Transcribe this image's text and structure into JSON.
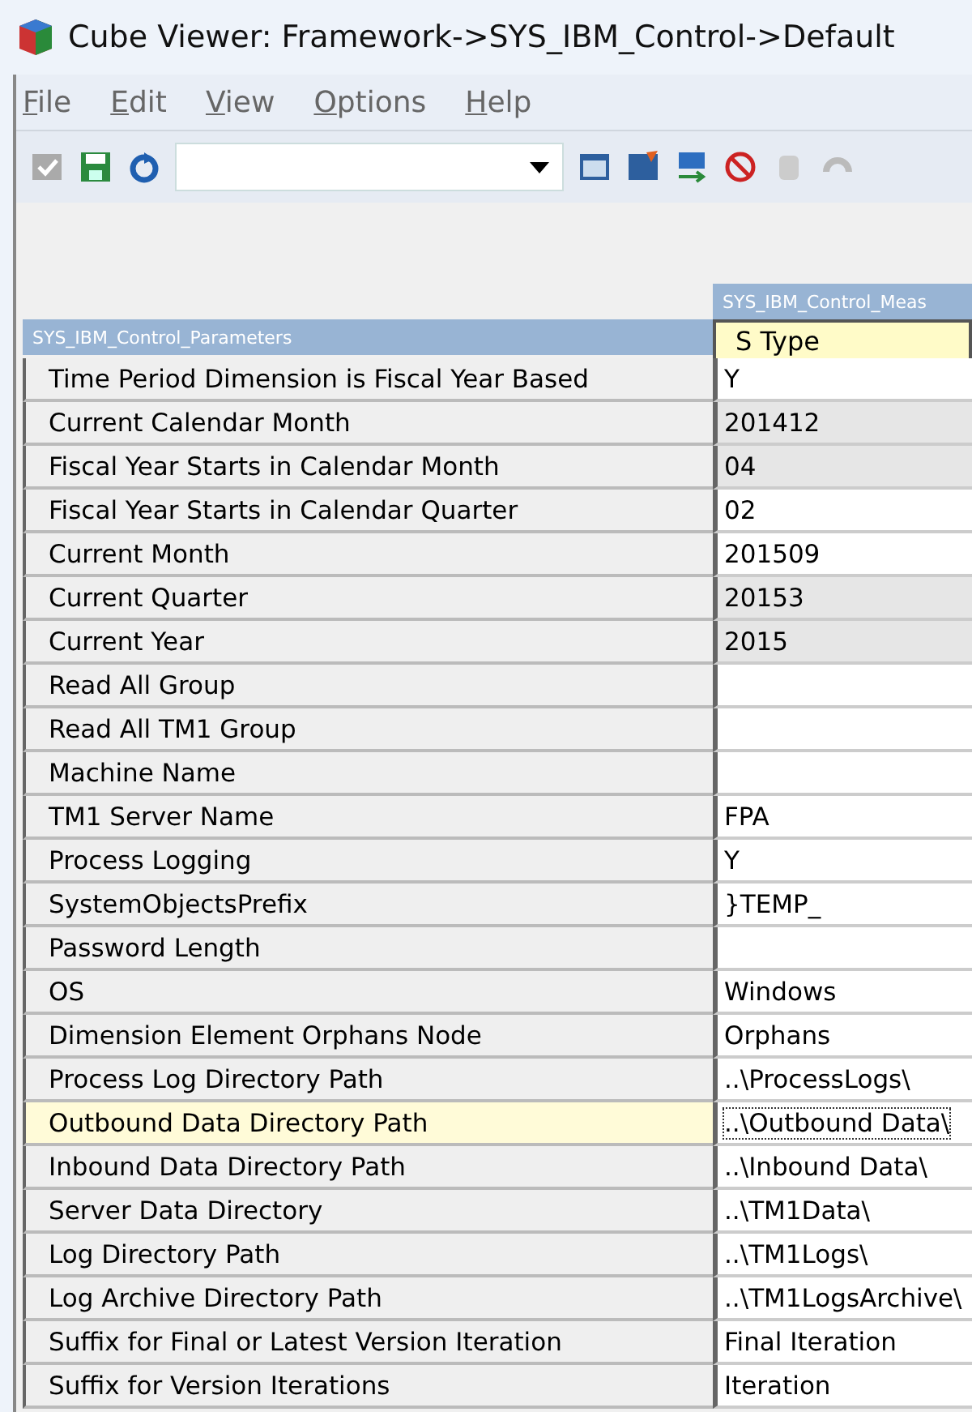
{
  "window": {
    "title": "Cube Viewer: Framework->SYS_IBM_Control->Default"
  },
  "menu": [
    {
      "label": "File"
    },
    {
      "label": "Edit"
    },
    {
      "label": "View"
    },
    {
      "label": "Options"
    },
    {
      "label": "Help"
    }
  ],
  "column_dimension": "SYS_IBM_Control_Meas",
  "row_dimension": "SYS_IBM_Control_Parameters",
  "column_header": "S Type",
  "rows": [
    {
      "label": "Time Period Dimension is Fiscal Year Based",
      "value": "Y",
      "shaded": false,
      "selected": false
    },
    {
      "label": "Current Calendar Month",
      "value": "201412",
      "shaded": true,
      "selected": false
    },
    {
      "label": "Fiscal Year Starts in Calendar Month",
      "value": "04",
      "shaded": true,
      "selected": false
    },
    {
      "label": "Fiscal Year Starts in Calendar Quarter",
      "value": "02",
      "shaded": false,
      "selected": false
    },
    {
      "label": "Current Month",
      "value": "201509",
      "shaded": false,
      "selected": false
    },
    {
      "label": "Current Quarter",
      "value": "20153",
      "shaded": true,
      "selected": false
    },
    {
      "label": "Current Year",
      "value": "2015",
      "shaded": true,
      "selected": false
    },
    {
      "label": "Read All Group",
      "value": "",
      "shaded": false,
      "selected": false
    },
    {
      "label": "Read All TM1 Group",
      "value": "",
      "shaded": false,
      "selected": false
    },
    {
      "label": "Machine Name",
      "value": "",
      "shaded": false,
      "selected": false
    },
    {
      "label": "TM1 Server Name",
      "value": "FPA",
      "shaded": false,
      "selected": false
    },
    {
      "label": "Process Logging",
      "value": "Y",
      "shaded": false,
      "selected": false
    },
    {
      "label": "SystemObjectsPrefix",
      "value": "}TEMP_",
      "shaded": false,
      "selected": false
    },
    {
      "label": "Password Length",
      "value": "",
      "shaded": false,
      "selected": false
    },
    {
      "label": "OS",
      "value": "Windows",
      "shaded": false,
      "selected": false
    },
    {
      "label": "Dimension Element Orphans Node",
      "value": "Orphans",
      "shaded": false,
      "selected": false
    },
    {
      "label": "Process Log Directory Path",
      "value": "..\\ProcessLogs\\",
      "shaded": false,
      "selected": false
    },
    {
      "label": "Outbound Data Directory Path",
      "value": "..\\Outbound Data\\",
      "shaded": false,
      "selected": true
    },
    {
      "label": "Inbound Data Directory Path",
      "value": "..\\Inbound Data\\",
      "shaded": false,
      "selected": false
    },
    {
      "label": "Server Data Directory",
      "value": "..\\TM1Data\\",
      "shaded": false,
      "selected": false
    },
    {
      "label": "Log Directory Path",
      "value": "..\\TM1Logs\\",
      "shaded": false,
      "selected": false
    },
    {
      "label": "Log Archive Directory Path",
      "value": "..\\TM1LogsArchive\\",
      "shaded": false,
      "selected": false
    },
    {
      "label": "Suffix for Final or Latest Version Iteration",
      "value": "Final Iteration",
      "shaded": false,
      "selected": false
    },
    {
      "label": "Suffix for Version Iterations",
      "value": "Iteration",
      "shaded": false,
      "selected": false
    }
  ]
}
